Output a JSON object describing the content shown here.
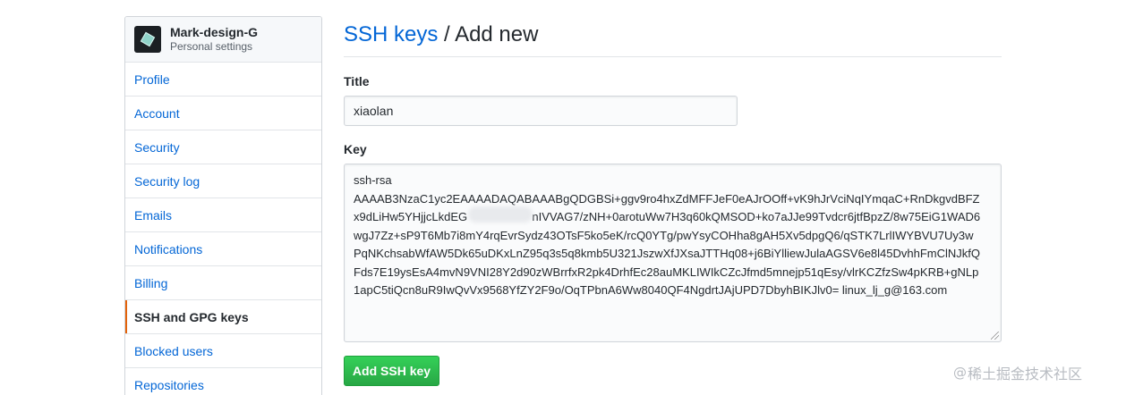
{
  "sidebar": {
    "user": {
      "name": "Mark-design-G",
      "subtitle": "Personal settings"
    },
    "items": [
      {
        "label": "Profile"
      },
      {
        "label": "Account"
      },
      {
        "label": "Security"
      },
      {
        "label": "Security log"
      },
      {
        "label": "Emails"
      },
      {
        "label": "Notifications"
      },
      {
        "label": "Billing"
      },
      {
        "label": "SSH and GPG keys",
        "selected": true
      },
      {
        "label": "Blocked users"
      },
      {
        "label": "Repositories"
      }
    ]
  },
  "main": {
    "breadcrumb_link": "SSH keys",
    "breadcrumb_separator": " / ",
    "breadcrumb_current": "Add new",
    "title_label": "Title",
    "title_value": "xiaolan",
    "key_label": "Key",
    "key_lines": [
      "ssh-rsa",
      "AAAAB3NzaC1yc2EAAAADAQABAAABgQDGBSi+ggv9ro4hxZdMFFJeF0eAJrOOff+vK9hJrVciNqIYmqaC+RnDkgvdBFZ",
      "x9dLiHw5YHjjcLkdEG                    nIVVAG7/zNH+0arotuWw7H3q60kQMSOD+ko7aJJe99Tvdcr6jtfBpzZ/8w75EiG1WAD6",
      "wgJ7Zz+sP9T6Mb7i8mY4rqEvrSydz43OTsF5ko5eK/rcQ0YTg/pwYsyCOHha8gAH5Xv5dpgQ6/qSTK7LrlIWYBVU7Uy3w",
      "PqNKchsabWfAW5Dk65uDKxLnZ95q3s5q8kmb5U321JszwXfJXsaJTTHq08+j6BiYlliewJulaAGSV6e8l45DvhhFmClNJkfQ",
      "Fds7E19ysEsA4mvN9VNI28Y2d90zWBrrfxR2pk4DrhfEc28auMKLIWIkCZcJfmd5mnejp51qEsy/vlrKCZfzSw4pKRB+gNLp",
      "1apC5tiQcn8uR9IwQvVx9568YfZY2F9o/OqTPbnA6Ww8040QF4NgdrtJAjUPD7DbyhBIKJlv0= linux_lj_g@163.com"
    ],
    "submit_label": "Add SSH key"
  },
  "watermark": {
    "symbol": "@",
    "text": "稀土掘金技术社区"
  },
  "colors": {
    "link": "#0366d6",
    "selected_accent": "#e36209",
    "button_green": "#28a745"
  }
}
